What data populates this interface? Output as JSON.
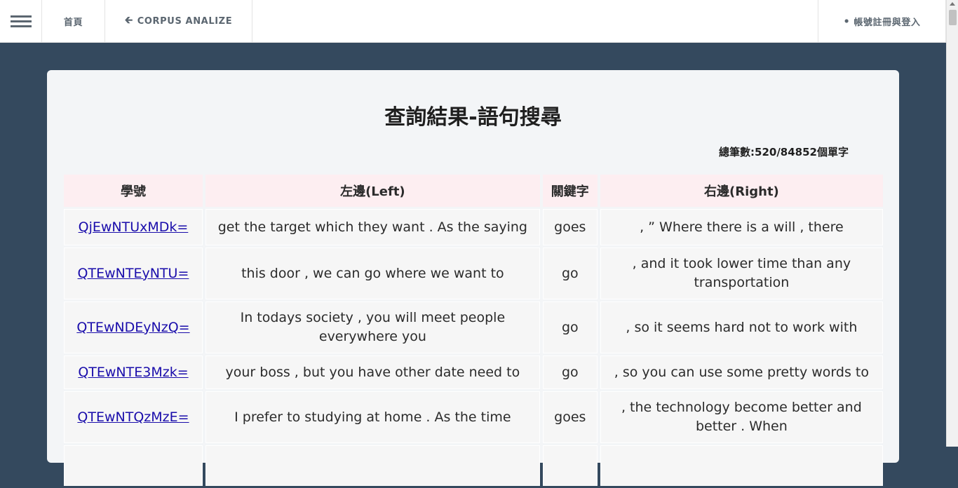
{
  "nav": {
    "home_label": "首頁",
    "back_label": "CORPUS ANALIZE",
    "login_label": "帳號註冊與登入"
  },
  "main": {
    "title": "查詢結果-語句搜尋",
    "count": "總筆數:520/84852個單字",
    "headers": [
      "學號",
      "左邊(Left)",
      "關鍵字",
      "右邊(Right)"
    ],
    "rows": [
      {
        "id": "QjEwNTUxMDk=",
        "left": "get the target which they want . As the saying",
        "keyword": "goes",
        "right": ", ”  Where there is a will , there"
      },
      {
        "id": "QTEwNTEyNTU=",
        "left": "this door , we can go where we want to",
        "keyword": "go",
        "right": ", and it took lower time than any transportation"
      },
      {
        "id": "QTEwNDEyNzQ=",
        "left": "In todays society , you will meet people everywhere you",
        "keyword": "go",
        "right": ", so it seems hard not to work with"
      },
      {
        "id": "QTEwNTE3Mzk=",
        "left": "your boss , but you have other date need to",
        "keyword": "go",
        "right": ", so you can use some pretty words to"
      },
      {
        "id": "QTEwNTQzMzE=",
        "left": "I prefer to studying at home . As the time",
        "keyword": "goes",
        "right": ", the technology become better and better . When"
      }
    ]
  }
}
